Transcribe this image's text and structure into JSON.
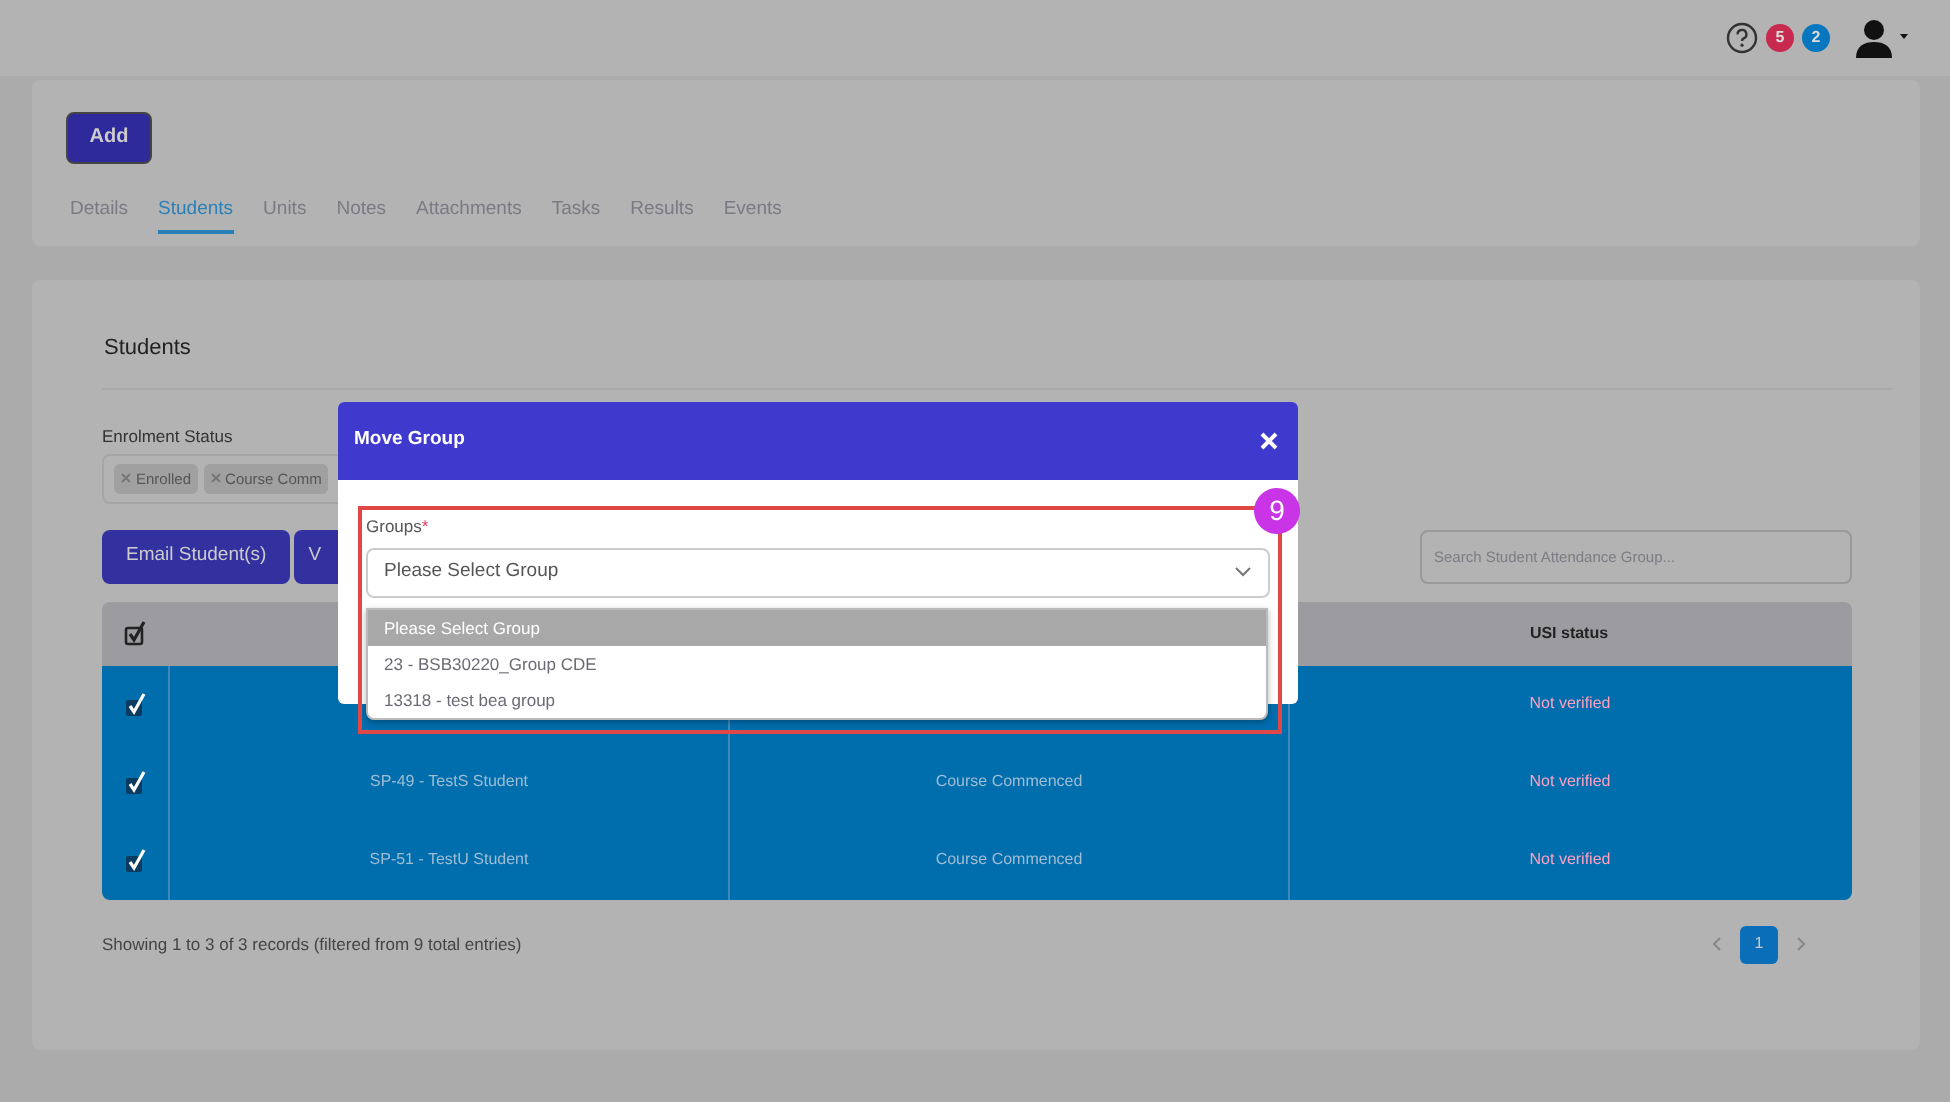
{
  "topbar": {
    "badges": [
      {
        "count": "5",
        "color": "#c8294f"
      },
      {
        "count": "2",
        "color": "#0877c0"
      }
    ]
  },
  "header_card": {
    "add_button": "Add",
    "tabs": [
      {
        "label": "Details",
        "selected": false
      },
      {
        "label": "Students",
        "selected": true
      },
      {
        "label": "Units",
        "selected": false
      },
      {
        "label": "Notes",
        "selected": false
      },
      {
        "label": "Attachments",
        "selected": false
      },
      {
        "label": "Tasks",
        "selected": false
      },
      {
        "label": "Results",
        "selected": false
      },
      {
        "label": "Events",
        "selected": false
      }
    ]
  },
  "students_card": {
    "title": "Students",
    "filter": {
      "label": "Enrolment Status",
      "tags": [
        "Enrolled",
        "Course Comm"
      ]
    },
    "buttons": [
      "Email Student(s)",
      "V"
    ],
    "search": {
      "placeholder": "Search Student Attendance Group..."
    },
    "table": {
      "all_checked": true,
      "columns": [
        {
          "kind": "check"
        },
        {
          "kind": "text"
        },
        {
          "kind": "text"
        },
        {
          "kind": "text",
          "label": "USI status"
        }
      ],
      "rows": [
        {
          "checked": true,
          "usi": "Not verified"
        },
        {
          "checked": true,
          "name": "SP-49 - TestS Student",
          "status": "Course Commenced",
          "usi": "Not verified"
        },
        {
          "checked": true,
          "name": "SP-51 - TestU Student",
          "status": "Course Commenced",
          "usi": "Not verified"
        }
      ]
    },
    "footer": "Showing 1 to 3 of 3 records (filtered from 9 total entries)",
    "pagination": [
      {
        "label": "1",
        "selected": true
      }
    ]
  },
  "modal": {
    "title": "Move Group",
    "field": {
      "label": "Groups",
      "required_mark": "*",
      "value": "Please Select Group"
    },
    "options": [
      {
        "label": "Please Select Group",
        "selected": true
      },
      {
        "label": "23 - BSB30220_Group CDE",
        "selected": false
      },
      {
        "label": "13318 - test bea group",
        "selected": false
      }
    ]
  },
  "annotation": {
    "label": "9"
  }
}
